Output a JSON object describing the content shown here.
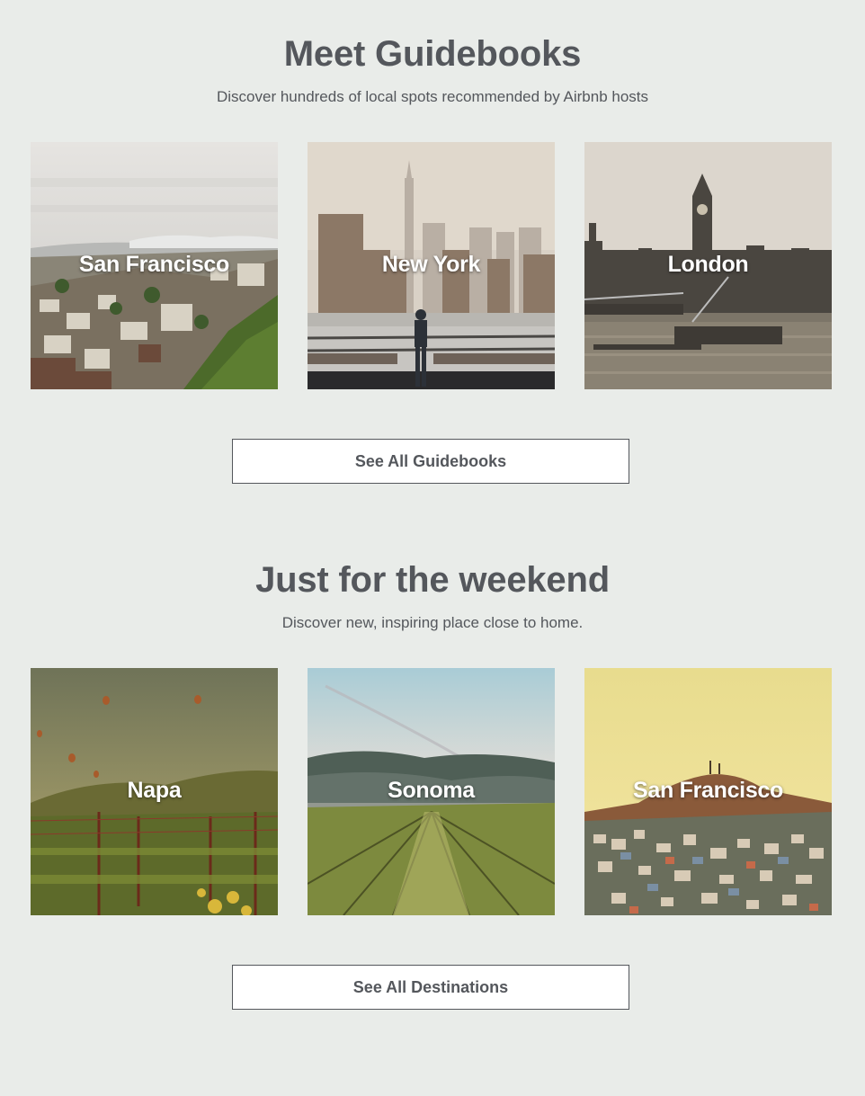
{
  "guidebooks": {
    "title": "Meet Guidebooks",
    "subtitle": "Discover hundreds of local spots recommended by Airbnb hosts",
    "cards": [
      {
        "label": "San Francisco"
      },
      {
        "label": "New York"
      },
      {
        "label": "London"
      }
    ],
    "button_label": "See All Guidebooks"
  },
  "weekend": {
    "title": "Just for the weekend",
    "subtitle": "Discover new, inspiring place close to home.",
    "cards": [
      {
        "label": "Napa"
      },
      {
        "label": "Sonoma"
      },
      {
        "label": "San Francisco"
      }
    ],
    "button_label": "See All Destinations"
  },
  "colors": {
    "background": "#e9ece9",
    "text": "#54575c",
    "button_bg": "#ffffff",
    "card_label": "#ffffff"
  }
}
